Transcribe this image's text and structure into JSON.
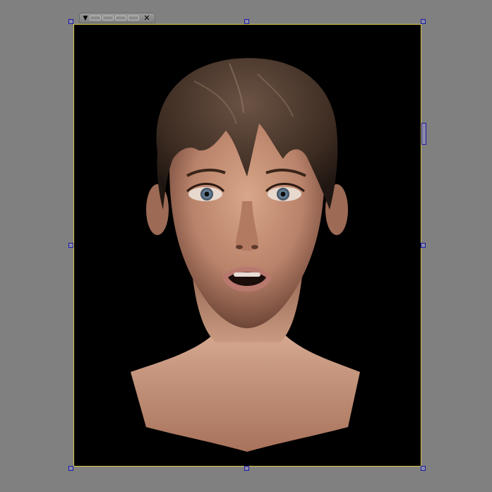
{
  "toolbar": {
    "menu_icon": "▼",
    "close_icon": "✕",
    "slot_count": 4
  },
  "colors": {
    "background": "#808080",
    "frame_border": "#d9c64a",
    "handle_border": "#1a1aa8",
    "render_background": "#000000"
  },
  "render": {
    "subject": "3d-head-render",
    "icon": "rendered-female-head-image"
  }
}
